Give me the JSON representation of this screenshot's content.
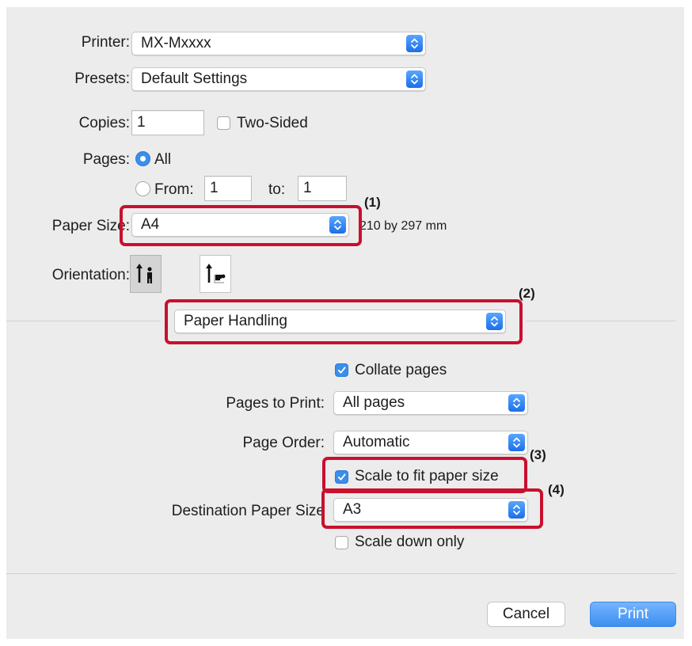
{
  "printer": {
    "label": "Printer:",
    "value": "MX-Mxxxx"
  },
  "presets": {
    "label": "Presets:",
    "value": "Default Settings"
  },
  "copies": {
    "label": "Copies:",
    "value": "1",
    "two_sided_label": "Two-Sided",
    "two_sided_checked": false
  },
  "pages": {
    "label": "Pages:",
    "all_label": "All",
    "all_selected": true,
    "from_label": "From:",
    "from_value": "1",
    "to_label": "to:",
    "to_value": "1"
  },
  "paper_size": {
    "label": "Paper Size:",
    "value": "A4",
    "dimensions": "210 by 297 mm"
  },
  "orientation": {
    "label": "Orientation:",
    "options": [
      "portrait",
      "landscape"
    ],
    "selected": "portrait"
  },
  "section_popup": {
    "value": "Paper Handling"
  },
  "paper_handling": {
    "collate_label": "Collate pages",
    "collate_checked": true,
    "pages_to_print_label": "Pages to Print:",
    "pages_to_print_value": "All pages",
    "page_order_label": "Page Order:",
    "page_order_value": "Automatic",
    "scale_to_fit_label": "Scale to fit paper size",
    "scale_to_fit_checked": true,
    "destination_label": "Destination Paper Size",
    "destination_value": "A3",
    "scale_down_label": "Scale down only",
    "scale_down_checked": false
  },
  "callouts": [
    "(1)",
    "(2)",
    "(3)",
    "(4)"
  ],
  "buttons": {
    "cancel": "Cancel",
    "print": "Print"
  },
  "colors": {
    "highlight": "#c8102e",
    "accent": "#3b8eea",
    "panel": "#ececec"
  }
}
